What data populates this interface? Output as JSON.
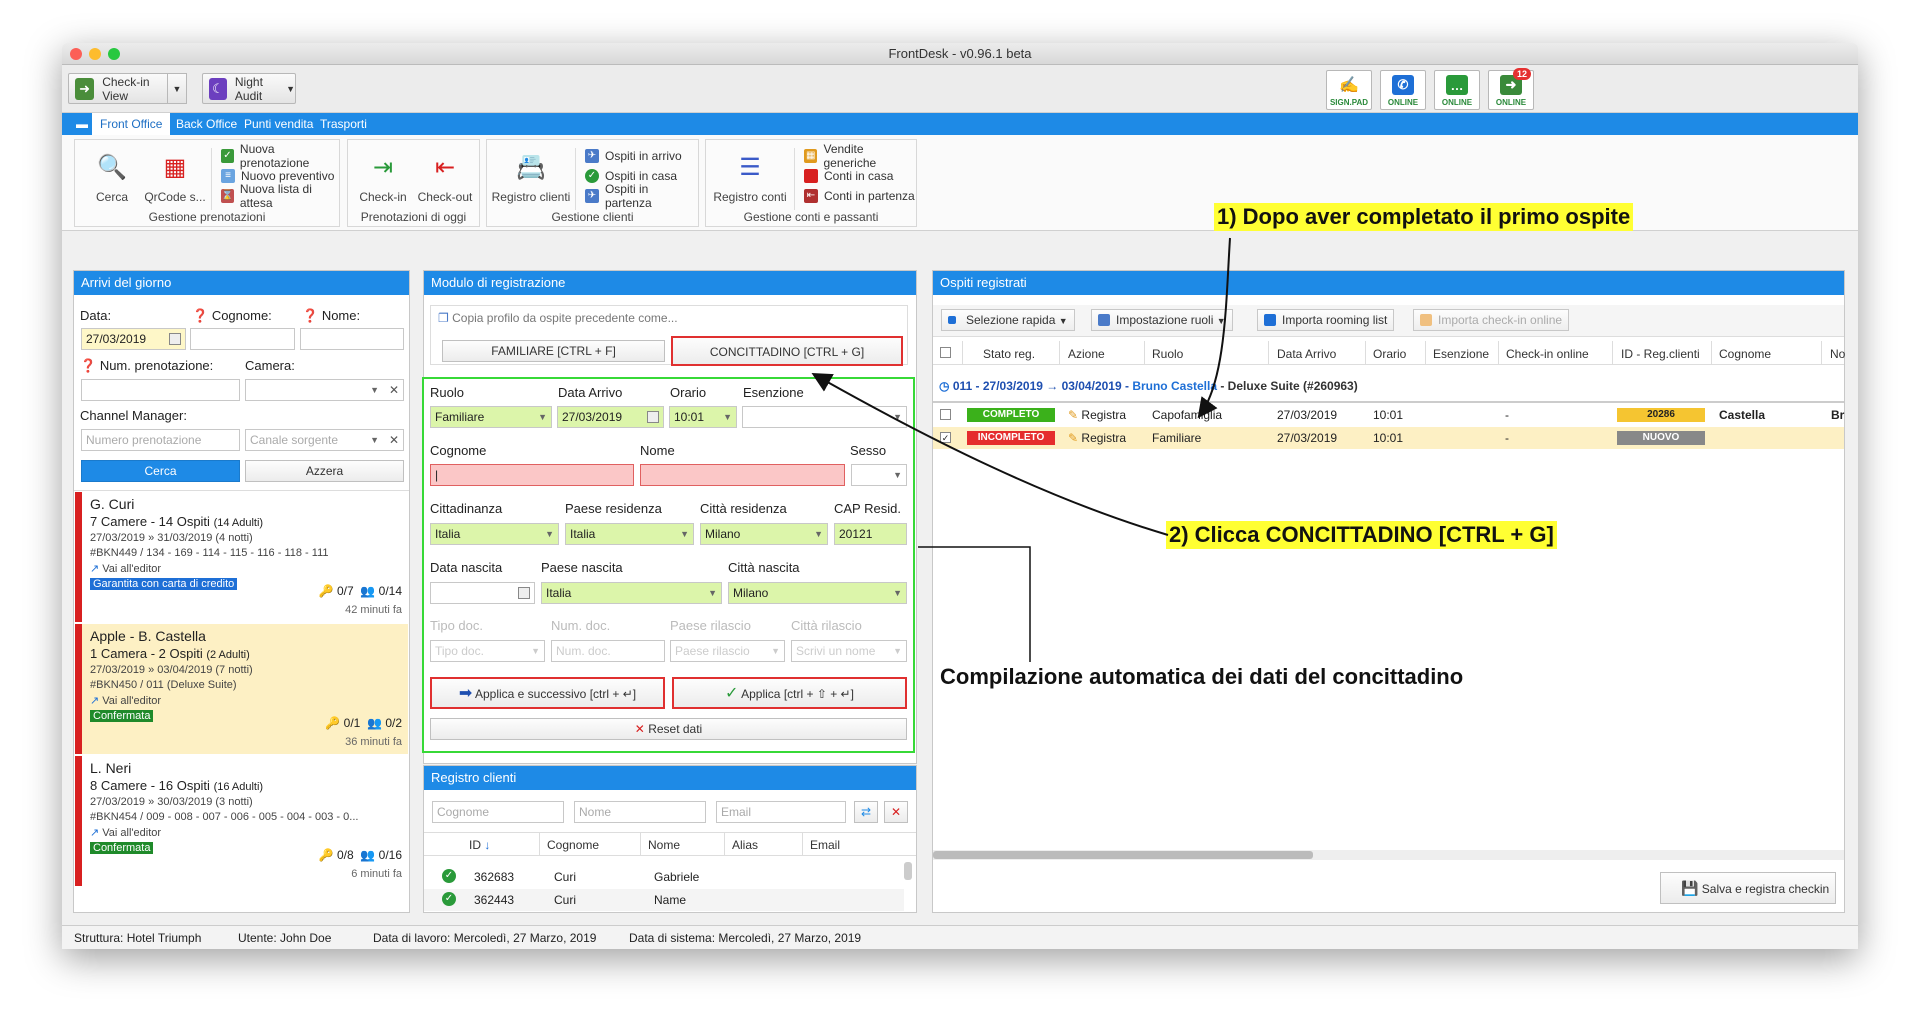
{
  "app": {
    "title": "FrontDesk - v0.96.1 beta"
  },
  "toolbar": {
    "checkin_view": "Check-in View",
    "night_audit": "Night Audit",
    "sign_pad": "SIGN.PAD",
    "online1": "ONLINE",
    "online2": "ONLINE",
    "online3": "ONLINE",
    "notif_count": "12"
  },
  "menu": [
    "Front Office",
    "Back Office",
    "Punti vendita",
    "Trasporti"
  ],
  "ribbon": {
    "cerca": "Cerca",
    "qrcode": "QrCode s...",
    "nuova_prenotazione": "Nuova prenotazione",
    "nuovo_preventivo": "Nuovo preventivo",
    "nuova_lista": "Nuova lista di attesa",
    "gestione_prenotazioni": "Gestione prenotazioni",
    "checkin": "Check-in",
    "checkout": "Check-out",
    "prenotazioni_oggi": "Prenotazioni di oggi",
    "registro_clienti": "Registro clienti",
    "ospiti_arrivo": "Ospiti in arrivo",
    "ospiti_casa": "Ospiti in casa",
    "ospiti_partenza": "Ospiti in partenza",
    "gestione_clienti": "Gestione clienti",
    "registro_conti": "Registro conti",
    "vendite_generiche": "Vendite generiche",
    "conti_casa": "Conti in casa",
    "conti_partenza": "Conti in partenza",
    "gestione_conti": "Gestione conti e passanti"
  },
  "arrivi": {
    "title": "Arrivi del giorno",
    "data_lbl": "Data:",
    "data_val": "27/03/2019",
    "cognome_lbl": "Cognome:",
    "nome_lbl": "Nome:",
    "num_pren_lbl": "Num. prenotazione:",
    "camera_lbl": "Camera:",
    "channel_lbl": "Channel Manager:",
    "num_pren_ph": "Numero prenotazione",
    "canale_ph": "Canale sorgente",
    "cerca": "Cerca",
    "azzera": "Azzera",
    "cards": [
      {
        "name": "G. Curi",
        "rooms": "7 Camere - 14 Ospiti",
        "adults": "(14 Adulti)",
        "dates": "27/03/2019 » 31/03/2019 (4 notti)",
        "ref": "#BKN449 / 134 - 169 - 114 - 115 - 116 - 118 - 111",
        "editor": "Vai all'editor",
        "keys": "0/7",
        "guests": "0/14",
        "tag": "Garantita con carta di credito",
        "mins": "42 minuti fa",
        "tagcolor": "#1e6fd6",
        "bg": "#ffffff"
      },
      {
        "name": "Apple - B. Castella",
        "rooms": "1 Camera - 2 Ospiti",
        "adults": "(2 Adulti)",
        "dates": "27/03/2019 » 03/04/2019 (7 notti)",
        "ref": "#BKN450 / 011 (Deluxe Suite)",
        "editor": "Vai all'editor",
        "keys": "0/1",
        "guests": "0/2",
        "tag": "Confermata",
        "mins": "36 minuti fa",
        "tagcolor": "#1f8a2a",
        "bg": "#fdf0c4"
      },
      {
        "name": "L. Neri",
        "rooms": "8 Camere - 16 Ospiti",
        "adults": "(16 Adulti)",
        "dates": "27/03/2019 » 30/03/2019 (3 notti)",
        "ref": "#BKN454 / 009 - 008 - 007 - 006 - 005 - 004 - 003 - 0...",
        "editor": "Vai all'editor",
        "keys": "0/8",
        "guests": "0/16",
        "tag": "Confermata",
        "mins": "6 minuti fa",
        "tagcolor": "#1f8a2a",
        "bg": "#ffffff"
      }
    ]
  },
  "modulo": {
    "title": "Modulo di registrazione",
    "copia": "Copia profilo da ospite precedente come...",
    "familiare_btn": "FAMILIARE [CTRL + F]",
    "concittadino_btn": "CONCITTADINO [CTRL + G]",
    "ruolo_lbl": "Ruolo",
    "ruolo_val": "Familiare",
    "data_arrivo_lbl": "Data Arrivo",
    "data_arrivo_val": "27/03/2019",
    "orario_lbl": "Orario",
    "orario_val": "10:01",
    "esenzione_lbl": "Esenzione",
    "cognome_lbl": "Cognome",
    "nome_lbl": "Nome",
    "sesso_lbl": "Sesso",
    "cittadinanza_lbl": "Cittadinanza",
    "cittadinanza_val": "Italia",
    "paese_res_lbl": "Paese residenza",
    "paese_res_val": "Italia",
    "citta_res_lbl": "Città residenza",
    "citta_res_val": "Milano",
    "cap_lbl": "CAP Resid.",
    "cap_val": "20121",
    "data_nascita_lbl": "Data nascita",
    "paese_nascita_lbl": "Paese nascita",
    "paese_nascita_val": "Italia",
    "citta_nascita_lbl": "Città nascita",
    "citta_nascita_val": "Milano",
    "tipo_doc_lbl": "Tipo doc.",
    "tipo_doc_ph": "Tipo doc.",
    "num_doc_lbl": "Num. doc.",
    "num_doc_ph": "Num. doc.",
    "paese_ril_lbl": "Paese rilascio",
    "paese_ril_ph": "Paese rilascio",
    "citta_ril_lbl": "Città rilascio",
    "citta_ril_ph": "Scrivi un nome",
    "applica_succ": "Applica e successivo [ctrl + ↵]",
    "applica": "Applica [ctrl + ⇧ + ↵]",
    "reset": "Reset dati"
  },
  "registro": {
    "title": "Registro clienti",
    "cognome_ph": "Cognome",
    "nome_ph": "Nome",
    "email_ph": "Email",
    "headers": [
      "ID",
      "Cognome",
      "Nome",
      "Alias",
      "Email"
    ],
    "rows": [
      {
        "id": "362683",
        "cognome": "Curi",
        "nome": "Gabriele"
      },
      {
        "id": "362443",
        "cognome": "Curi",
        "nome": "Name"
      }
    ]
  },
  "ospiti": {
    "title": "Ospiti registrati",
    "selezione": "Selezione rapida",
    "impostazione": "Impostazione ruoli",
    "importa": "Importa rooming list",
    "importa_online": "Importa check-in online",
    "headers": [
      "Stato reg.",
      "Azione",
      "Ruolo",
      "Data Arrivo",
      "Orario",
      "Esenzione",
      "Check-in online",
      "ID - Reg.clienti",
      "Cognome",
      "No"
    ],
    "group_prefix": "011 - 27/03/2019 → 03/04/2019 - ",
    "group_name": "Bruno Castella",
    "group_suffix": " - Deluxe Suite (#260963)",
    "rows": [
      {
        "stato": "COMPLETO",
        "azione": "Registra",
        "ruolo": "Capofamiglia",
        "data": "27/03/2019",
        "orario": "10:01",
        "checkin": "-",
        "id": "20286",
        "cognome": "Castella",
        "no": "Br"
      },
      {
        "stato": "INCOMPLETO",
        "azione": "Registra",
        "ruolo": "Familiare",
        "data": "27/03/2019",
        "orario": "10:01",
        "checkin": "-",
        "id": "NUOVO",
        "cognome": "",
        "no": ""
      }
    ],
    "salva": "Salva e registra checkin"
  },
  "status": {
    "struttura": "Struttura: Hotel Triumph",
    "utente": "Utente: John Doe",
    "data_lavoro": "Data di lavoro: Mercoledì, 27 Marzo, 2019",
    "data_sistema": "Data di sistema: Mercoledì, 27 Marzo, 2019"
  },
  "annotations": {
    "step1": "1) Dopo aver completato il primo ospite",
    "step2": "2) Clicca CONCITTADINO [CTRL + G]",
    "caption": "Compilazione automatica dei dati del concittadino"
  },
  "colors": {
    "accent": "#1e8ae6",
    "completo": "#3bb11b",
    "incompleto": "#e52d2d",
    "highlight": "#ffff33",
    "form_border": "#37d937"
  }
}
